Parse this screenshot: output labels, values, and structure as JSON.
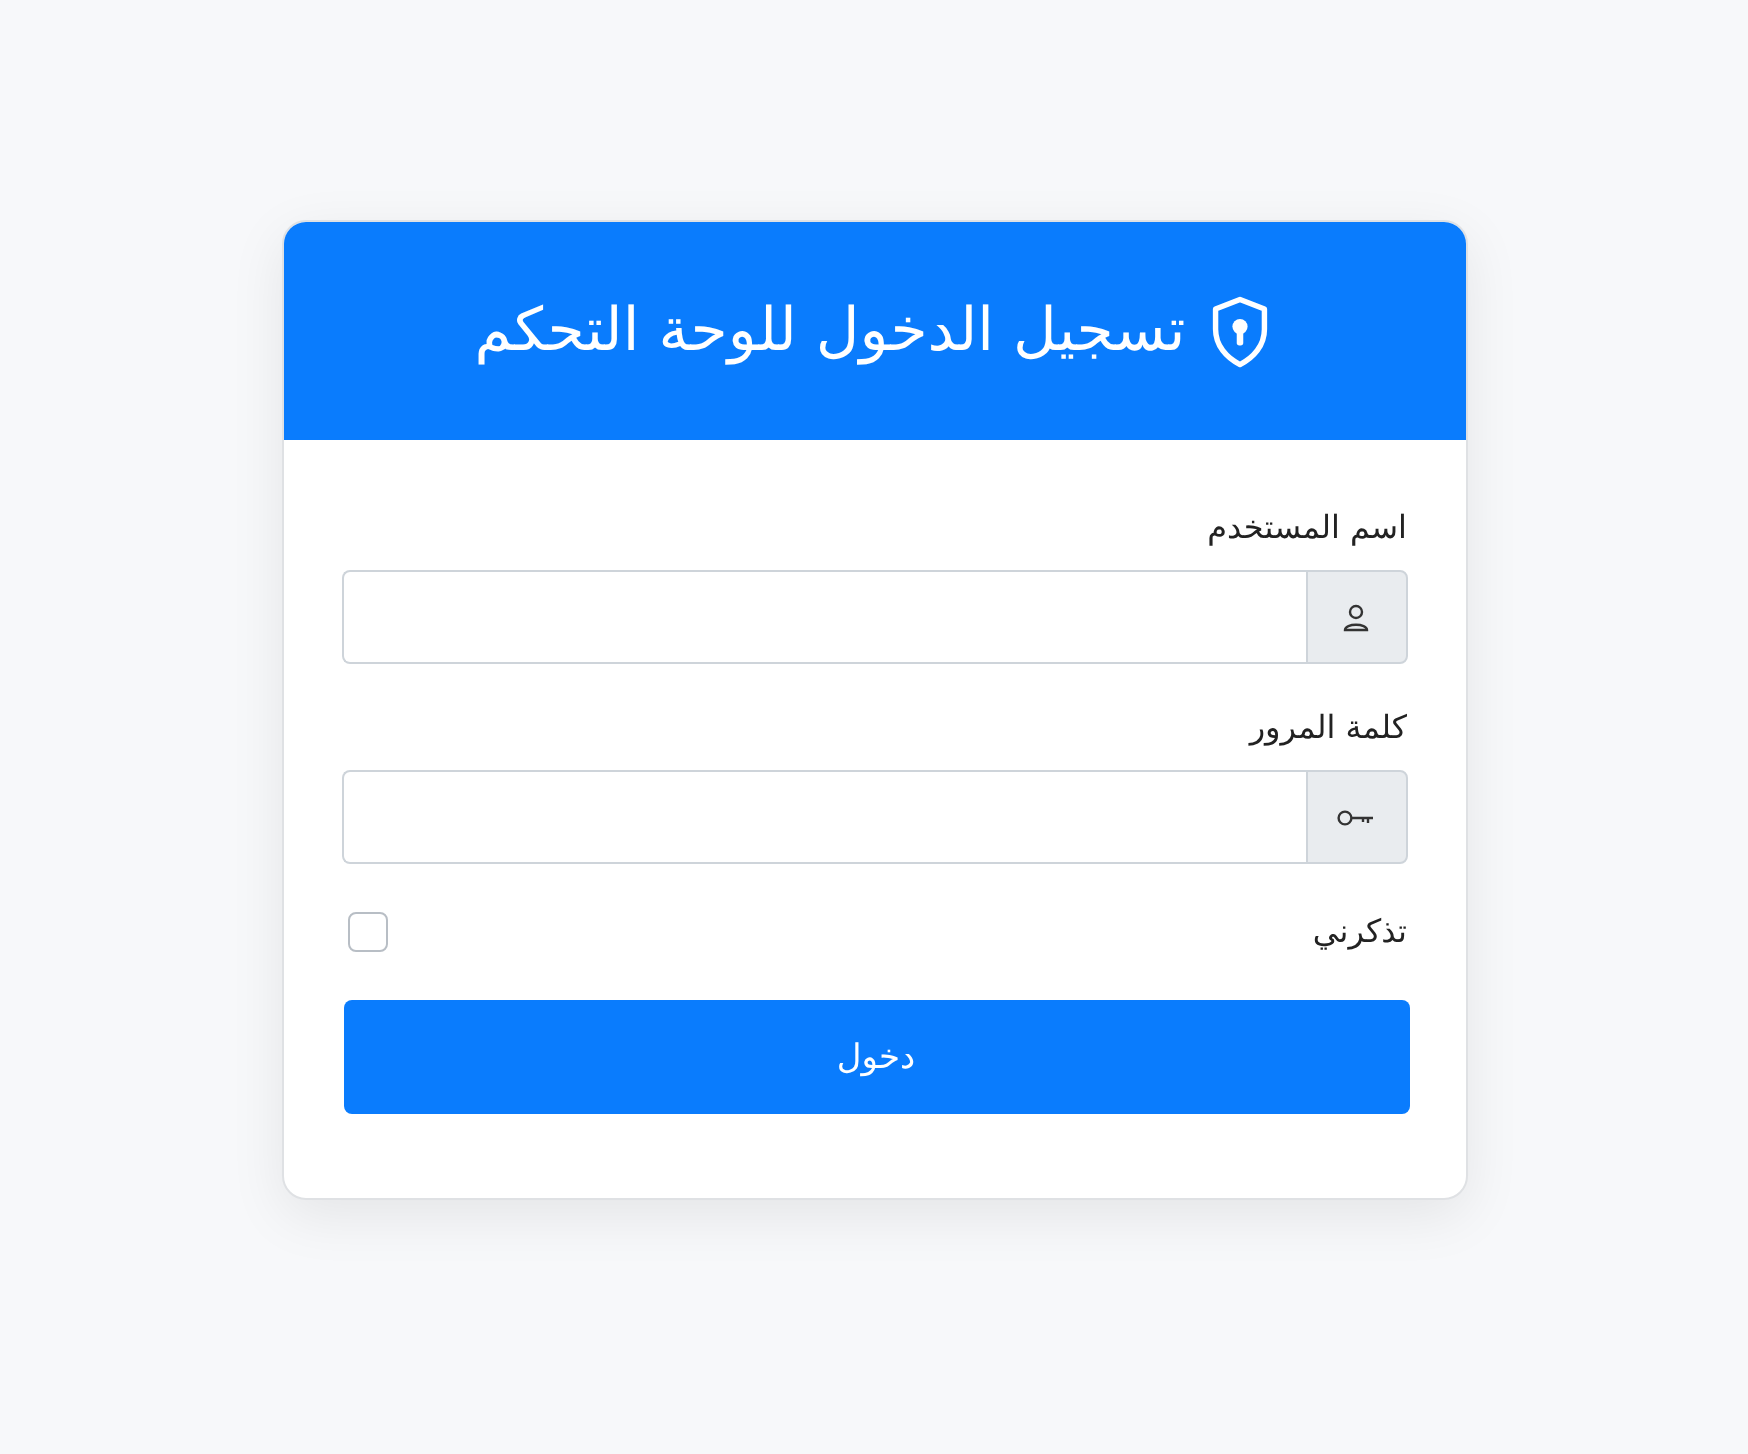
{
  "header": {
    "title": "تسجيل الدخول للوحة التحكم"
  },
  "fields": [
    {
      "kind": "user",
      "label": "اسم المستخدم"
    },
    {
      "kind": "key",
      "label": "كلمة المرور"
    }
  ],
  "remember": {
    "label": "تذكرني",
    "checked": false
  },
  "submit": {
    "label": "دخول"
  }
}
